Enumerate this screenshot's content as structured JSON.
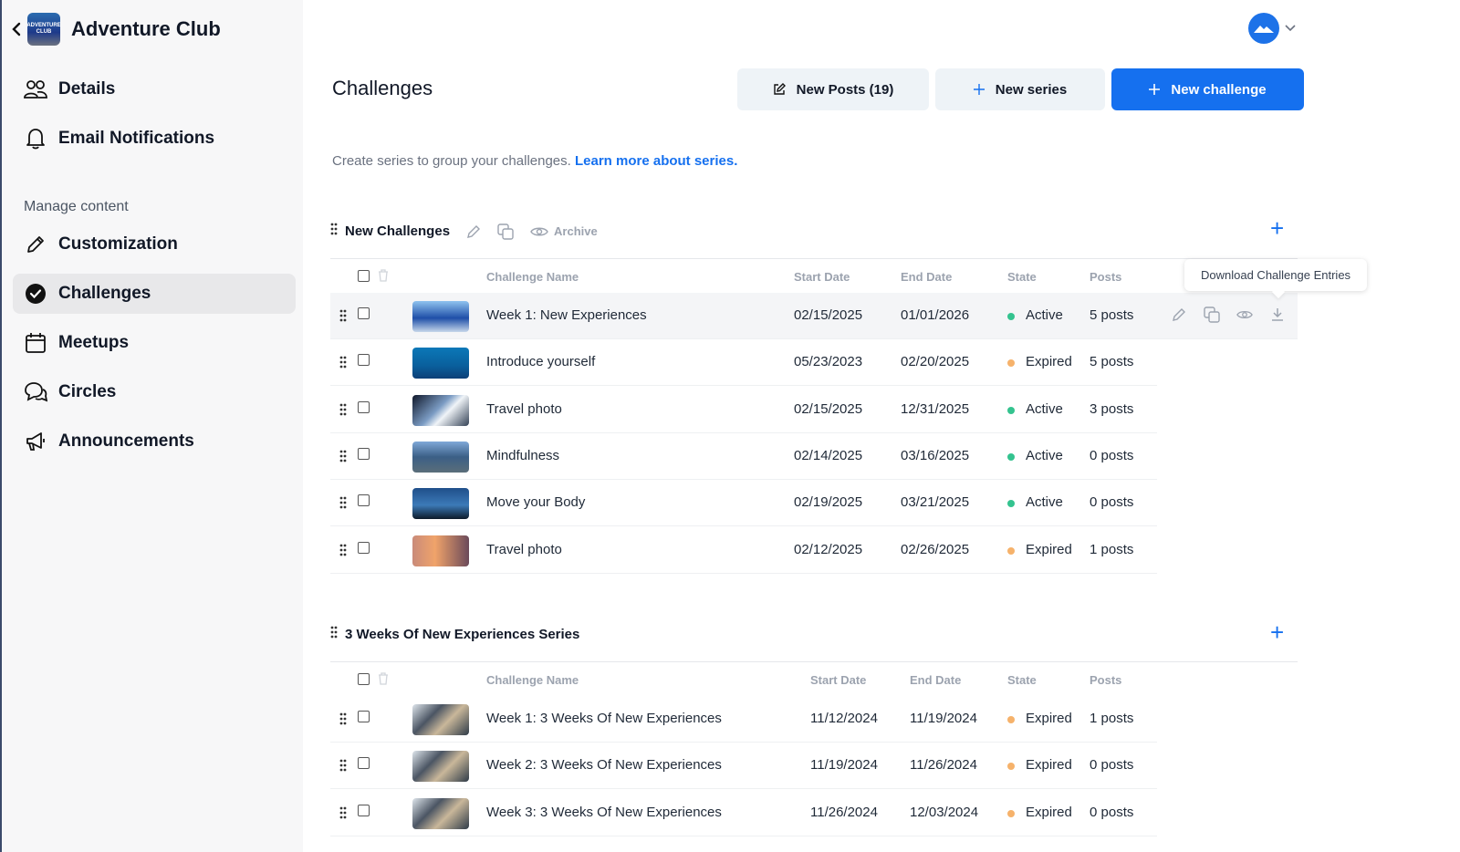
{
  "sidebar": {
    "club_name": "Adventure Club",
    "logo_text": "ADVENTURE CLUB",
    "items_top": [
      {
        "label": "Details",
        "icon": "users-icon"
      },
      {
        "label": "Email Notifications",
        "icon": "bell-icon"
      }
    ],
    "section_label": "Manage content",
    "items_manage": [
      {
        "label": "Customization",
        "icon": "pencil-icon"
      },
      {
        "label": "Challenges",
        "icon": "check-circle-icon",
        "active": true
      },
      {
        "label": "Meetups",
        "icon": "calendar-icon"
      },
      {
        "label": "Circles",
        "icon": "chat-bubbles-icon"
      },
      {
        "label": "Announcements",
        "icon": "megaphone-icon"
      }
    ]
  },
  "header": {
    "title": "Challenges",
    "new_posts_label": "New Posts (19)",
    "new_series_label": "New series",
    "new_challenge_label": "New challenge"
  },
  "info": {
    "text": "Create series to group your challenges. ",
    "link": "Learn more about series."
  },
  "columns": {
    "name": "Challenge Name",
    "start": "Start Date",
    "end": "End Date",
    "state": "State",
    "posts": "Posts"
  },
  "groups": [
    {
      "name": "New Challenges",
      "archive_label": "Archive",
      "rows": [
        {
          "name": "Week 1: New Experiences",
          "start": "02/15/2025",
          "end": "01/01/2026",
          "state": "Active",
          "posts": "5 posts"
        },
        {
          "name": "Introduce yourself",
          "start": "05/23/2023",
          "end": "02/20/2025",
          "state": "Expired",
          "posts": "5 posts"
        },
        {
          "name": "Travel photo",
          "start": "02/15/2025",
          "end": "12/31/2025",
          "state": "Active",
          "posts": "3 posts"
        },
        {
          "name": "Mindfulness",
          "start": "02/14/2025",
          "end": "03/16/2025",
          "state": "Active",
          "posts": "0 posts"
        },
        {
          "name": "Move your Body",
          "start": "02/19/2025",
          "end": "03/21/2025",
          "state": "Active",
          "posts": "0 posts"
        },
        {
          "name": "Travel photo",
          "start": "02/12/2025",
          "end": "02/26/2025",
          "state": "Expired",
          "posts": "1 posts"
        }
      ]
    },
    {
      "name": "3 Weeks Of New Experiences Series",
      "rows": [
        {
          "name": "Week 1: 3 Weeks Of New Experiences",
          "start": "11/12/2024",
          "end": "11/19/2024",
          "state": "Expired",
          "posts": "1 posts"
        },
        {
          "name": "Week 2: 3 Weeks Of New Experiences",
          "start": "11/19/2024",
          "end": "11/26/2024",
          "state": "Expired",
          "posts": "0 posts"
        },
        {
          "name": "Week 3: 3 Weeks Of New Experiences",
          "start": "11/26/2024",
          "end": "12/03/2024",
          "state": "Expired",
          "posts": "0 posts"
        }
      ]
    }
  ],
  "tooltip": "Download Challenge Entries",
  "colors": {
    "accent": "#1570ef",
    "active": "#34c38f",
    "expired": "#f6b26b"
  }
}
